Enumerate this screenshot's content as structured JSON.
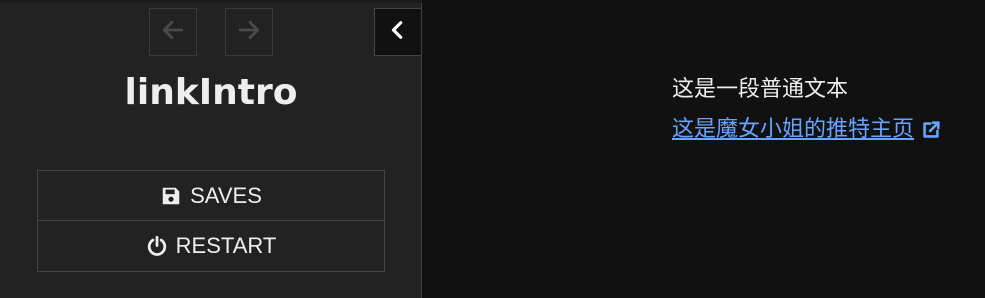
{
  "sidebar": {
    "story_title": "linkIntro",
    "menu": {
      "saves_label": "SAVES",
      "restart_label": "RESTART"
    }
  },
  "passage": {
    "plain_text": "这是一段普通文本",
    "link_text": "这是魔女小姐的推特主页"
  },
  "colors": {
    "background": "#111111",
    "sidebar": "#222222",
    "text": "#eeeeee",
    "link": "#68a4ff",
    "disabled": "#444444"
  },
  "icons": [
    "arrow-left-icon",
    "arrow-right-icon",
    "chevron-left-icon",
    "floppy-disk-icon",
    "power-icon",
    "external-link-icon"
  ]
}
